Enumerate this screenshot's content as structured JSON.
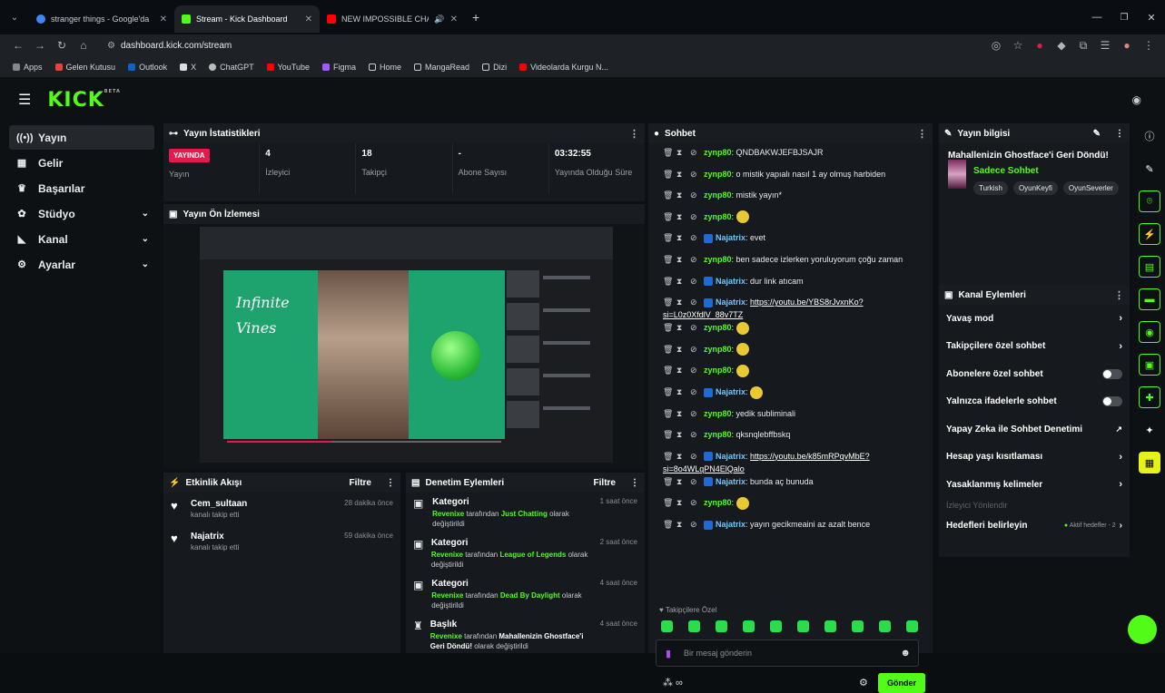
{
  "browser": {
    "tabs": [
      {
        "label": "stranger things - Google'da Ara",
        "color": "#4285f4"
      },
      {
        "label": "Stream - Kick Dashboard",
        "color": "#53fc18"
      },
      {
        "label": "NEW IMPOSSIBLE CHALLE",
        "color": "#ff0000"
      }
    ],
    "url": "dashboard.kick.com/stream",
    "bookmarks": [
      "Apps",
      "Gelen Kutusu",
      "Outlook",
      "X",
      "ChatGPT",
      "YouTube",
      "Figma",
      "Home",
      "MangaRead",
      "Dizi",
      "Videolarda Kurgu N..."
    ]
  },
  "header": {
    "logo": "KICK",
    "logo_badge": "BETA"
  },
  "sidebar": {
    "items": [
      {
        "label": "Yayın",
        "icon": "broadcast-icon"
      },
      {
        "label": "Gelir",
        "icon": "revenue-icon"
      },
      {
        "label": "Başarılar",
        "icon": "trophy-icon"
      },
      {
        "label": "Stüdyo",
        "icon": "studio-icon"
      },
      {
        "label": "Kanal",
        "icon": "channel-icon"
      },
      {
        "label": "Ayarlar",
        "icon": "gear-icon"
      }
    ]
  },
  "stats": {
    "title": "Yayın İstatistikleri",
    "live_badge": "YAYINDA",
    "items": [
      {
        "value": "",
        "label": "Yayın"
      },
      {
        "value": "4",
        "label": "İzleyici"
      },
      {
        "value": "18",
        "label": "Takipçi"
      },
      {
        "value": "-",
        "label": "Abone Sayısı"
      },
      {
        "value": "03:32:55",
        "label": "Yayında Olduğu Süre"
      }
    ]
  },
  "preview": {
    "title": "Yayın Ön İzlemesi",
    "video_text_1": "Infinite",
    "video_text_2": "Vines"
  },
  "activity": {
    "title": "Etkinlik Akışı",
    "filter": "Filtre",
    "items": [
      {
        "name": "Cem_sultaan",
        "sub": "kanalı takip etti",
        "time": "28 dakika önce"
      },
      {
        "name": "Najatrix",
        "sub": "kanalı takip etti",
        "time": "59 dakika önce"
      }
    ]
  },
  "moderation": {
    "title": "Denetim Eylemleri",
    "filter": "Filtre",
    "items": [
      {
        "type": "Kategori",
        "user": "Revenixe",
        "mid": " tarafından ",
        "val": "Just Chatting",
        "end": " olarak değiştirildi",
        "time": "1 saat önce"
      },
      {
        "type": "Kategori",
        "user": "Revenixe",
        "mid": " tarafından ",
        "val": "League of Legends",
        "end": " olarak değiştirildi",
        "time": "2 saat önce"
      },
      {
        "type": "Kategori",
        "user": "Revenixe",
        "mid": " tarafından ",
        "val": "Dead By Daylight",
        "end": " olarak değiştirildi",
        "time": "4 saat önce"
      },
      {
        "type": "Başlık",
        "user": "Revenixe",
        "mid": " tarafından ",
        "val": "Mahallenizin Ghostface'i Geri Döndü!",
        "end": " olarak değiştirildi",
        "time": "4 saat önce"
      }
    ]
  },
  "chat": {
    "title": "Sohbet",
    "messages": [
      {
        "user": "zynp80",
        "text": "QNDBAKWJEFBJSAJR",
        "badge": false,
        "link": false
      },
      {
        "user": "zynp80",
        "text": "o mistik yapıalı nasıl 1 ay olmuş harbiden",
        "badge": false,
        "link": false
      },
      {
        "user": "zynp80",
        "text": "mistik yayın*",
        "badge": false,
        "link": false
      },
      {
        "user": "zynp80",
        "text": "",
        "badge": false,
        "link": false,
        "emoji": true
      },
      {
        "user": "Najatrix",
        "text": "evet",
        "badge": true,
        "link": false
      },
      {
        "user": "zynp80",
        "text": "ben sadece izlerken yoruluyorum çoğu zaman",
        "badge": false,
        "link": false
      },
      {
        "user": "Najatrix",
        "text": "dur link atıcam",
        "badge": true,
        "link": false
      },
      {
        "user": "Najatrix",
        "text": "https://youtu.be/YBS8rJvxnKo?si=L0z0XfdlV_88v7TZ",
        "badge": true,
        "link": true
      },
      {
        "user": "zynp80",
        "text": "",
        "badge": false,
        "link": false,
        "emoji": true
      },
      {
        "user": "zynp80",
        "text": "",
        "badge": false,
        "link": false,
        "emoji": true
      },
      {
        "user": "zynp80",
        "text": "",
        "badge": false,
        "link": false,
        "emoji": true
      },
      {
        "user": "Najatrix",
        "text": "",
        "badge": true,
        "link": false,
        "emoji": true
      },
      {
        "user": "zynp80",
        "text": "yedik subliminali",
        "badge": false,
        "link": false
      },
      {
        "user": "zynp80",
        "text": "qksnqlebffbskq",
        "badge": false,
        "link": false
      },
      {
        "user": "Najatrix",
        "text": "https://youtu.be/k85mRPqvMbE?si=8o4WLqPN4ElQalo",
        "badge": true,
        "link": true
      },
      {
        "user": "Najatrix",
        "text": "bunda aç bunuda",
        "badge": true,
        "link": false
      },
      {
        "user": "zynp80",
        "text": "",
        "badge": false,
        "link": false,
        "emoji": true
      },
      {
        "user": "Najatrix",
        "text": "yayın gecikmeaini az azalt bence",
        "badge": true,
        "link": false
      }
    ],
    "followers_only": "Takipçilere Özel",
    "placeholder": "Bir mesaj gönderin",
    "send": "Gönder"
  },
  "stream_info": {
    "title": "Yayın bilgisi",
    "stream_title": "Mahallenizin Ghostface'i Geri Döndü!",
    "category": "Sadece Sohbet",
    "tags": [
      "Turkish",
      "OyunKeyfi",
      "OyunSeverler"
    ]
  },
  "channel_actions": {
    "title": "Kanal Eylemleri",
    "items": [
      {
        "label": "Yavaş mod",
        "control": "chevron"
      },
      {
        "label": "Takipçilere özel sohbet",
        "control": "chevron"
      },
      {
        "label": "Abonelere özel sohbet",
        "control": "toggle"
      },
      {
        "label": "Yalnızca ifadelerle sohbet",
        "control": "toggle"
      },
      {
        "label": "Yapay Zeka ile Sohbet Denetimi",
        "control": "external"
      },
      {
        "label": "Hesap yaşı kısıtlaması",
        "control": "chevron"
      },
      {
        "label": "Yasaklanmış kelimeler",
        "control": "chevron"
      }
    ],
    "viewer_section": "İzleyici Yönlendir",
    "goals_label": "Hedefleri belirleyin",
    "goals_status": "Aktif hedefler - 2"
  },
  "colors": {
    "accent": "#53fc18",
    "live": "#e5194d"
  }
}
